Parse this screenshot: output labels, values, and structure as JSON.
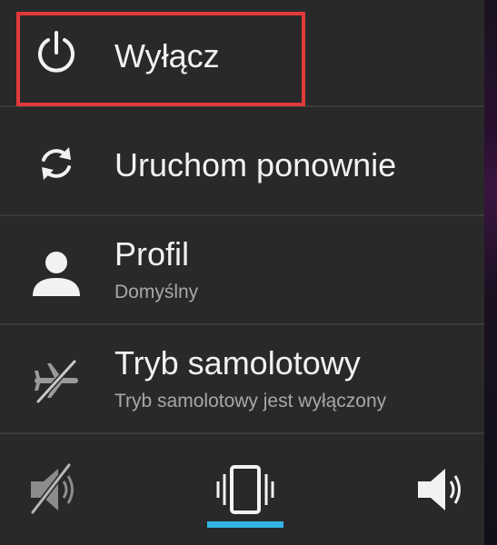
{
  "power_menu": {
    "items": [
      {
        "title": "Wyłącz",
        "subtitle": "",
        "icon": "power-icon"
      },
      {
        "title": "Uruchom ponownie",
        "subtitle": "",
        "icon": "restart-icon"
      },
      {
        "title": "Profil",
        "subtitle": "Domyślny",
        "icon": "profile-icon"
      },
      {
        "title": "Tryb samolotowy",
        "subtitle": "Tryb samolotowy jest wyłączony",
        "icon": "airplane-off-icon"
      }
    ],
    "sound_modes": [
      {
        "name": "silent",
        "icon": "volume-muted-icon",
        "active": false
      },
      {
        "name": "vibrate",
        "icon": "vibrate-icon",
        "active": true
      },
      {
        "name": "sound",
        "icon": "volume-on-icon",
        "active": false
      }
    ],
    "colors": {
      "background": "#292929",
      "divider": "#3a3a3a",
      "text": "#f2f2f2",
      "subtext": "#a8a8a8",
      "active_indicator": "#33b5e5",
      "highlight_box": "#e23a3a"
    }
  }
}
